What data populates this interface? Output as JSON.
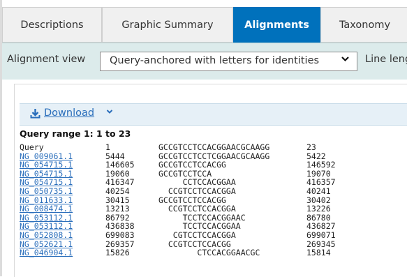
{
  "tabs": [
    {
      "label": "Descriptions",
      "active": false
    },
    {
      "label": "Graphic Summary",
      "active": false
    },
    {
      "label": "Alignments",
      "active": true
    },
    {
      "label": "Taxonomy",
      "active": false
    }
  ],
  "toolbar": {
    "alignment_view_label": "Alignment view",
    "alignment_view_value": "Query-anchored with letters for identities",
    "line_length_label": "Line leng"
  },
  "download": {
    "label": "Download",
    "icon": "download-icon"
  },
  "query_range": "Query range 1: 1 to 23",
  "alignment": [
    {
      "id": "Query",
      "start": "1",
      "seq": "GCCGTCCTCCACGGAACGCAAGG",
      "end": "23",
      "link": false
    },
    {
      "id": "NG_009061.1",
      "start": "5444",
      "seq": "GCCGTCCTCCTCGGAACGCAAGG",
      "end": "5422",
      "link": true
    },
    {
      "id": "NG_054715.1",
      "start": "146605",
      "seq": "GCCGTCCTCCACGG",
      "end": "146592",
      "link": true
    },
    {
      "id": "NG_054715.1",
      "start": "19060",
      "seq": "GCCGTCCTCCA",
      "end": "19070",
      "link": true
    },
    {
      "id": "NG_054715.1",
      "start": "416347",
      "seq": "     CCTCCACGGAA",
      "end": "416357",
      "link": true
    },
    {
      "id": "NG_050735.1",
      "start": "40254",
      "seq": "  CCGTCCTCCACGGA",
      "end": "40241",
      "link": true
    },
    {
      "id": "NG_011633.1",
      "start": "30415",
      "seq": "GCCGTCCTCCACGG",
      "end": "30402",
      "link": true
    },
    {
      "id": "NG_008474.1",
      "start": "13213",
      "seq": "  CCGTCCTCCACGGA",
      "end": "13226",
      "link": true
    },
    {
      "id": "NG_053112.1",
      "start": "86792",
      "seq": "     TCCTCCACGGAAC",
      "end": "86780",
      "link": true
    },
    {
      "id": "NG_053112.1",
      "start": "436838",
      "seq": "     TCCTCCACGGAA",
      "end": "436827",
      "link": true
    },
    {
      "id": "NG_052808.1",
      "start": "699083",
      "seq": "   CGTCCTCCACGGA",
      "end": "699071",
      "link": true
    },
    {
      "id": "NG_052621.1",
      "start": "269357",
      "seq": "  CCGTCCTCCACGG",
      "end": "269345",
      "link": true
    },
    {
      "id": "NG_046904.1",
      "start": "15826",
      "seq": "        CTCCACGGAACGC",
      "end": "15814",
      "link": true
    }
  ]
}
